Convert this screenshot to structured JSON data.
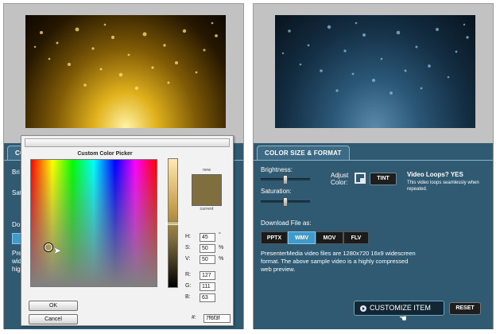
{
  "left_panel": {
    "tab_label": "CO",
    "partial_labels": {
      "brightness": "Bri",
      "saturation": "Sat",
      "download": "Do",
      "description_lines": [
        "Pre",
        "wid",
        "hig"
      ]
    }
  },
  "right_panel": {
    "tab_label": "COLOR SIZE & FORMAT",
    "brightness_label": "Brightness:",
    "saturation_label": "Saturation:",
    "adjust_color_label_1": "Adjust",
    "adjust_color_label_2": "Color:",
    "tint_button": "TINT",
    "video_loops_label": "Video Loops? YES",
    "video_loops_note": "This video loops seamlessly when repeated.",
    "download_label": "Download File as:",
    "formats": [
      {
        "label": "PPTX",
        "active": false
      },
      {
        "label": "WMV",
        "active": true
      },
      {
        "label": "MOV",
        "active": false
      },
      {
        "label": "FLV",
        "active": false
      }
    ],
    "description": "PresenterMedia video files are 1280x720 16x9 widescreen format. The above sample video is a highly compressed web preview.",
    "customize_button": "CUSTOMIZE ITEM",
    "reset_button": "RESET"
  },
  "color_picker": {
    "title": "Custom Color Picker",
    "new_label": "new",
    "current_label": "current",
    "fields": {
      "H": {
        "label": "H:",
        "value": "45",
        "unit": "°"
      },
      "S": {
        "label": "S:",
        "value": "50",
        "unit": "%"
      },
      "V": {
        "label": "V:",
        "value": "50",
        "unit": "%"
      },
      "R": {
        "label": "R:",
        "value": "127"
      },
      "G": {
        "label": "G:",
        "value": "111"
      },
      "B": {
        "label": "B:",
        "value": "63"
      }
    },
    "hex_label": "#:",
    "hex_value": "7f6f3f",
    "ok_button": "OK",
    "cancel_button": "Cancel",
    "selected_color": "#7f6f3f"
  },
  "colors": {
    "panel_bg": "#2f5a72",
    "active_format": "#3f9bcb"
  }
}
